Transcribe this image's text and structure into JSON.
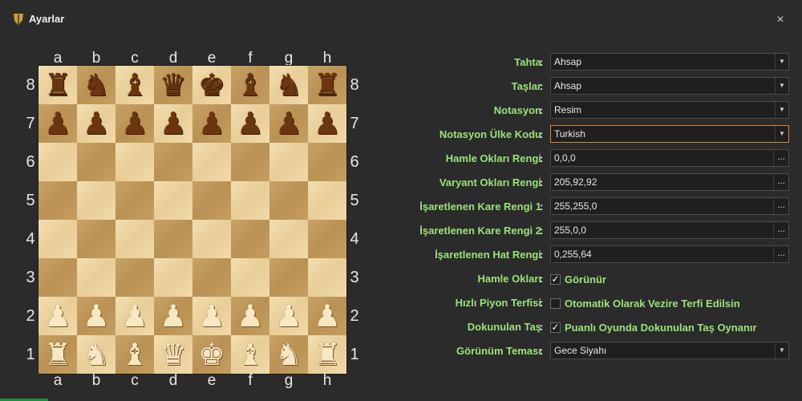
{
  "window": {
    "title": "Ayarlar",
    "close_icon": "×"
  },
  "board": {
    "files": [
      "a",
      "b",
      "c",
      "d",
      "e",
      "f",
      "g",
      "h"
    ],
    "ranks": [
      "8",
      "7",
      "6",
      "5",
      "4",
      "3",
      "2",
      "1"
    ],
    "pieces": {
      "8": [
        "r",
        "n",
        "b",
        "q",
        "k",
        "b",
        "n",
        "r"
      ],
      "7": [
        "p",
        "p",
        "p",
        "p",
        "p",
        "p",
        "p",
        "p"
      ],
      "2": [
        "P",
        "P",
        "P",
        "P",
        "P",
        "P",
        "P",
        "P"
      ],
      "1": [
        "R",
        "N",
        "B",
        "Q",
        "K",
        "B",
        "N",
        "R"
      ]
    }
  },
  "settings": {
    "tahta": {
      "label": "Tahta",
      "value": "Ahsap"
    },
    "taslar": {
      "label": "Taşlar",
      "value": "Ahsap"
    },
    "notasyon": {
      "label": "Notasyon",
      "value": "Resim"
    },
    "notasyon_ulke": {
      "label": "Notasyon Ülke Kodu",
      "value": "Turkish"
    },
    "hamle_oklari_rengi": {
      "label": "Hamle Okları Rengi",
      "value": "0,0,0"
    },
    "varyant_oklari_rengi": {
      "label": "Varyant Okları Rengi",
      "value": "205,92,92"
    },
    "kare_rengi_1": {
      "label": "İşaretlenen Kare Rengi 1",
      "value": "255,255,0"
    },
    "kare_rengi_2": {
      "label": "İşaretlenen Kare Rengi 2",
      "value": "255,0,0"
    },
    "hat_rengi": {
      "label": "İşaretlenen Hat Rengi",
      "value": "0,255,64"
    },
    "hamle_oklari": {
      "label": "Hamle Okları",
      "checked": true,
      "text": "Görünür"
    },
    "piyon_terfisi": {
      "label": "Hızlı Piyon Terfisi",
      "checked": false,
      "text": "Otomatik Olarak Vezire Terfi Edilsin"
    },
    "dokunulan_tas": {
      "label": "Dokunulan Taş",
      "checked": true,
      "text": "Puanlı Oyunda Dokunulan Taş Oynanır"
    },
    "gorunum_temasi": {
      "label": "Görünüm Teması",
      "value": "Gece Siyahı"
    }
  },
  "colon": ":",
  "colors": {
    "label_green": "#9be37a",
    "accent_orange": "#d9823b",
    "background": "#2b2b2b"
  }
}
